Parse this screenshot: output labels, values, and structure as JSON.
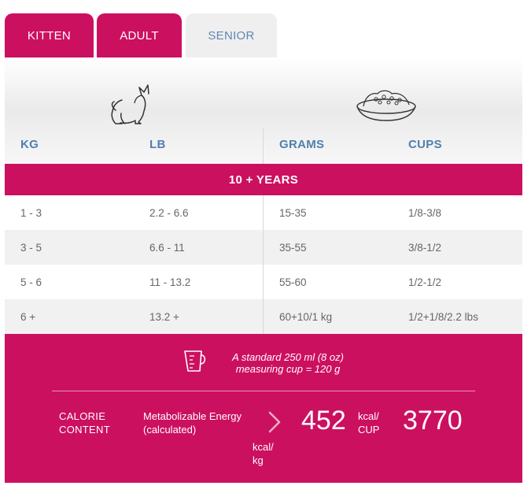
{
  "tabs": [
    {
      "label": "KITTEN"
    },
    {
      "label": "ADULT"
    },
    {
      "label": "SENIOR"
    }
  ],
  "active_tab": "SENIOR",
  "columns": [
    "KG",
    "LB",
    "GRAMS",
    "CUPS"
  ],
  "age_band": "10 + YEARS",
  "rows": [
    {
      "kg": "1 - 3",
      "lb": "2.2 - 6.6",
      "grams": "15-35",
      "cups": "1/8-3/8"
    },
    {
      "kg": "3 - 5",
      "lb": "6.6 - 11",
      "grams": "35-55",
      "cups": "3/8-1/2"
    },
    {
      "kg": "5 - 6",
      "lb": "11 - 13.2",
      "grams": "55-60",
      "cups": "1/2-1/2"
    },
    {
      "kg": "6 +",
      "lb": "13.2 +",
      "grams": "60+10/1 kg",
      "cups": "1/2+1/8/2.2 lbs"
    }
  ],
  "footer": {
    "note_line1": "A standard 250 ml (8 oz)",
    "note_line2": "measuring cup = 120 g",
    "calorie_line1": "CALORIE",
    "calorie_line2": "CONTENT",
    "me_line1": "Metabolizable Energy",
    "me_line2": "(calculated)",
    "kcal_kg_value": "3770",
    "kcal_kg_unit_line1": "kcal/",
    "kcal_kg_unit_line2": "kg",
    "kcal_cup_value": "452",
    "kcal_cup_unit_line1": "kcal/",
    "kcal_cup_unit_line2": "CUP"
  },
  "icons": [
    "cat-icon",
    "food-bowl-icon",
    "measuring-cup-icon",
    "chevron-right-icon"
  ],
  "colors": {
    "accent": "#cc1060",
    "header_text": "#4f7fb0",
    "tab_inactive_text": "#5f86b4"
  }
}
